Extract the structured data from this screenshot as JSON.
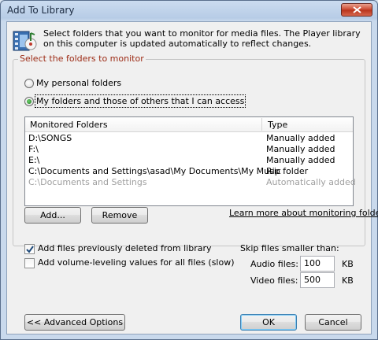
{
  "window": {
    "title": "Add To Library"
  },
  "header": {
    "text": "Select folders that you want to monitor for media files. The Player library on this computer is updated automatically to reflect changes."
  },
  "group": {
    "title": "Select the folders to monitor",
    "radio_personal": "My personal folders",
    "radio_all": "My folders and those of others that I can access",
    "selected": "radio_all"
  },
  "table": {
    "columns": [
      "Monitored Folders",
      "Type"
    ],
    "rows": [
      {
        "folder": "D:\\SONGS",
        "type": "Manually added",
        "disabled": false
      },
      {
        "folder": "F:\\",
        "type": "Manually added",
        "disabled": false
      },
      {
        "folder": "E:\\",
        "type": "Manually added",
        "disabled": false
      },
      {
        "folder": "C:\\Documents and Settings\\asad\\My Documents\\My Music",
        "type": "Rip folder",
        "disabled": false
      },
      {
        "folder": "C:\\Documents and Settings",
        "type": "Automatically added",
        "disabled": true
      }
    ]
  },
  "buttons": {
    "add": "Add...",
    "remove": "Remove",
    "advanced": "<< Advanced Options",
    "ok": "OK",
    "cancel": "Cancel"
  },
  "links": {
    "learn_more": "Learn more about monitoring folders"
  },
  "options": {
    "add_deleted": {
      "label": "Add files previously deleted from library",
      "checked": true
    },
    "volume_leveling": {
      "label": "Add volume-leveling values for all files (slow)",
      "checked": false
    }
  },
  "skip": {
    "title": "Skip files smaller than:",
    "audio_label": "Audio files:",
    "audio_value": "100",
    "audio_unit": "KB",
    "video_label": "Video files:",
    "video_value": "500",
    "video_unit": "KB"
  }
}
